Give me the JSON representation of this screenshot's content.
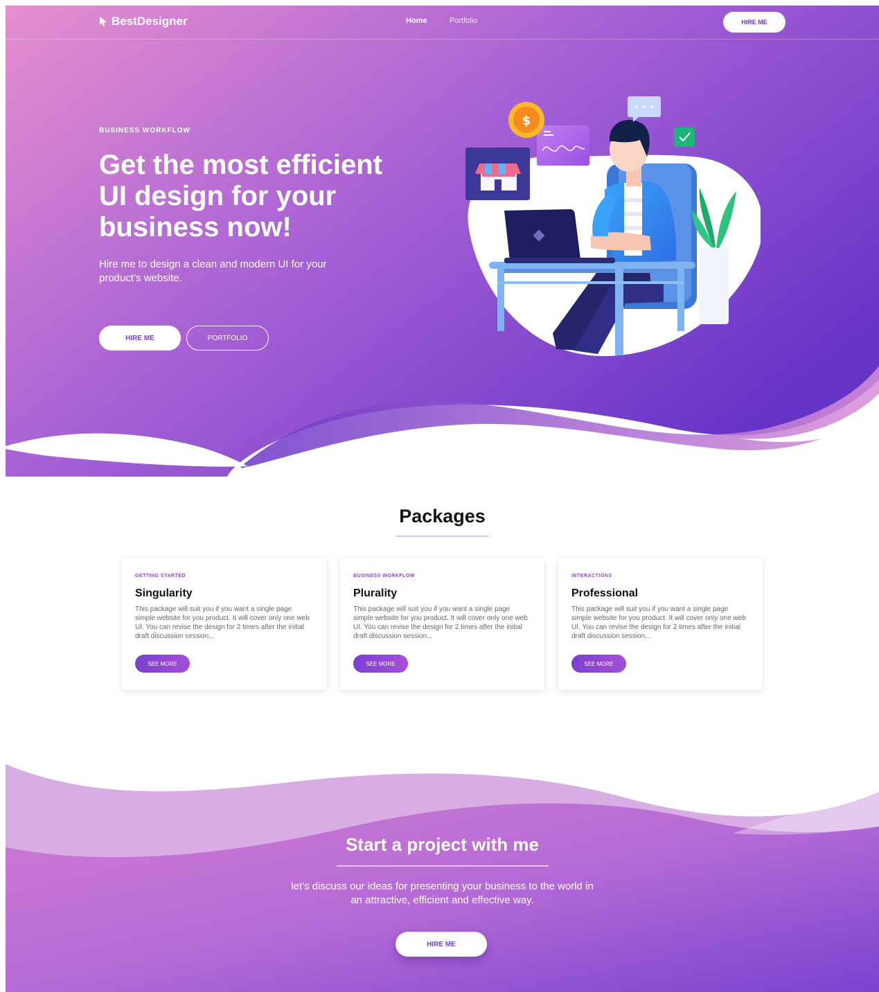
{
  "nav": {
    "brand": "BestDesigner",
    "links": [
      {
        "label": "Home",
        "active": true
      },
      {
        "label": "Portfolio",
        "active": false
      }
    ],
    "hire_label": "HIRE ME"
  },
  "hero": {
    "eyebrow": "BUSINESS WORKFLOW",
    "title": "Get the most efficient UI design for your business now!",
    "subtitle": "Hire me to design a clean and modern UI for your product’s website.",
    "hire_label": "HIRE ME",
    "portfolio_label": "PORTFOLIO",
    "coin_symbol": "$"
  },
  "packages": {
    "title": "Packages",
    "cards": [
      {
        "tag": "GETTING STARTED",
        "title": "Singularity",
        "text": "This package will suit you if you want a single page simple website for you product. It  will cover only one web UI.  You can  revise the design for 2 times  after the initial draft  discussion session...",
        "button": "SEE MORE"
      },
      {
        "tag": "BUSINESS WORKFLOW",
        "title": "Plurality",
        "text": "This package will suit you if you want a single page simple website for you product. It  will cover only one web UI.  You can  revise the design for 2 times  after the initial draft  discussion session...",
        "button": "SEE MORE"
      },
      {
        "tag": "INTERACTIONS",
        "title": "Professional",
        "text": "This package will suit you if you want a single page simple website for you product. It  will cover only one web UI.  You can  revise the design for 2 times  after the initial draft  discussion session...",
        "button": "SEE MORE"
      }
    ]
  },
  "cta": {
    "title": "Start a project with me",
    "text": "let’s discuss our ideas for presenting your business to the world in an attractive,  efficient and effective way.",
    "button": "HIRE ME"
  },
  "colors": {
    "gradient_start": "#e48fd0",
    "gradient_mid": "#a45fd5",
    "gradient_end": "#6a36c9",
    "accent": "#7a3fd0"
  }
}
